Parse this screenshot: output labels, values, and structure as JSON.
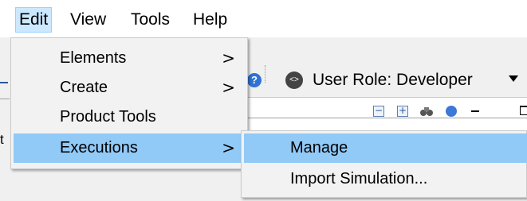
{
  "menubar": {
    "items": [
      {
        "label": "Edit"
      },
      {
        "label": "View"
      },
      {
        "label": "Tools"
      },
      {
        "label": "Help"
      }
    ]
  },
  "toolbar": {
    "help_glyph": "?",
    "role_glyph": "<>",
    "user_role_label": "User Role: Developer"
  },
  "edit_menu": {
    "items": [
      {
        "label": "Elements",
        "submenu_glyph": ">"
      },
      {
        "label": "Create",
        "submenu_glyph": ">"
      },
      {
        "label": "Product Tools"
      },
      {
        "label": "Executions",
        "submenu_glyph": ">"
      }
    ]
  },
  "executions_submenu": {
    "items": [
      {
        "label": "Manage"
      },
      {
        "label": "Import Simulation..."
      }
    ]
  },
  "panel": {
    "collapse_glyph": "−",
    "expand_glyph": "+"
  },
  "left_stub": {
    "text": "t"
  },
  "colors": {
    "menu_highlight": "#91c9f7",
    "menubar_open": "#cce8ff",
    "menu_bg": "#f2f2f2"
  }
}
